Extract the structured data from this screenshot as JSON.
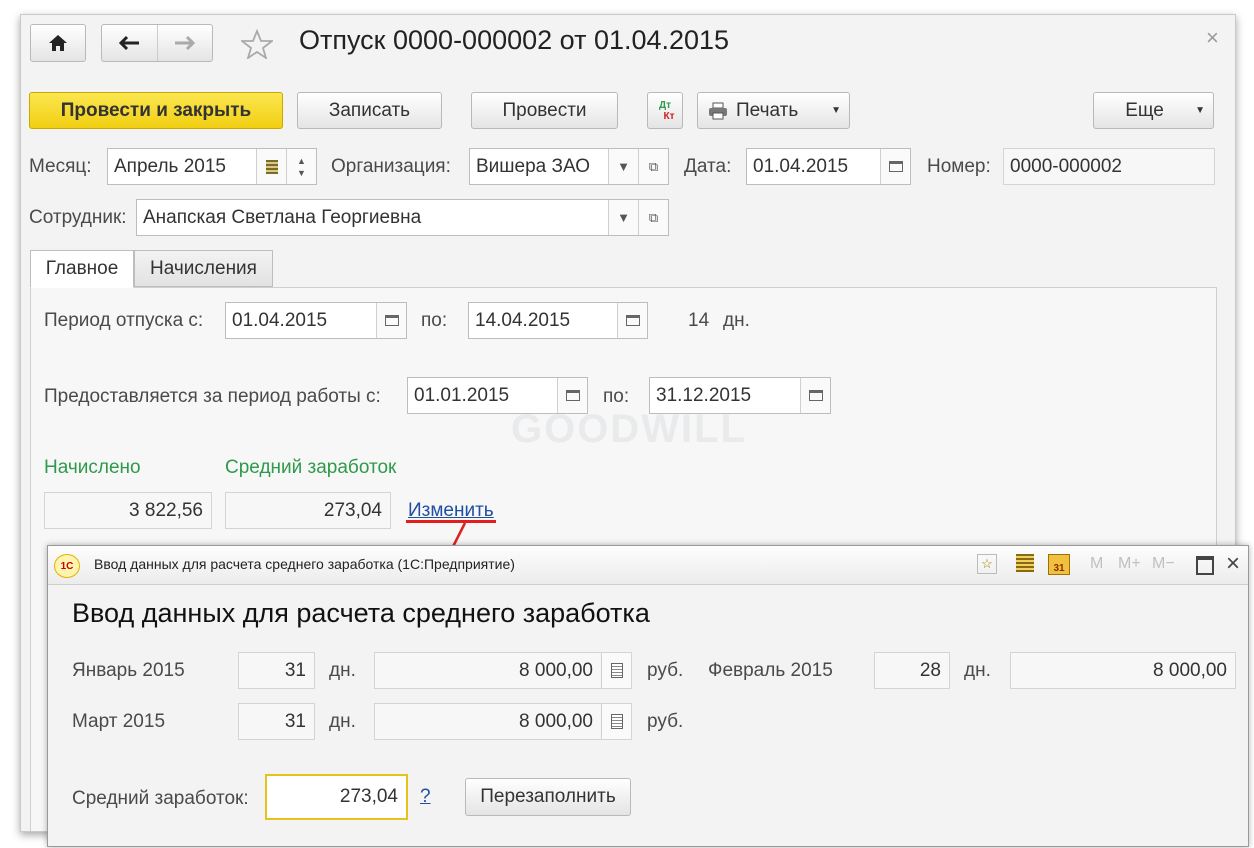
{
  "window": {
    "title": "Отпуск 0000-000002 от 01.04.2015",
    "close_glyph": "×"
  },
  "toolbar": {
    "post_close": "Провести и закрыть",
    "save": "Записать",
    "post": "Провести",
    "dtkt_top": "Дт",
    "dtkt_bottom": "Кт",
    "print": "Печать",
    "more": "Еще"
  },
  "header": {
    "month_label": "Месяц:",
    "month_value": "Апрель 2015",
    "org_label": "Организация:",
    "org_value": "Вишера ЗАО",
    "date_label": "Дата:",
    "date_value": "01.04.2015",
    "number_label": "Номер:",
    "number_value": "0000-000002",
    "employee_label": "Сотрудник:",
    "employee_value": "Анапская Светлана Георгиевна"
  },
  "tabs": [
    {
      "label": "Главное"
    },
    {
      "label": "Начисления"
    }
  ],
  "main": {
    "period_label": "Период отпуска с:",
    "period_from": "01.04.2015",
    "to_label": "по:",
    "period_to": "14.04.2015",
    "days_count": "14",
    "days_unit": "дн.",
    "work_period_label": "Предоставляется за период работы с:",
    "work_from": "01.01.2015",
    "work_to_label": "по:",
    "work_to": "31.12.2015",
    "accrued_label": "Начислено",
    "accrued_value": "3 822,56",
    "avg_label": "Средний заработок",
    "avg_value": "273,04",
    "change_link": "Изменить"
  },
  "watermark": "GOODWILL",
  "dialog": {
    "logo": "1С",
    "titlebar": "Ввод данных для расчета среднего заработка  (1С:Предприятие)",
    "toolbar_icons": [
      "M",
      "M+",
      "M−"
    ],
    "heading": "Ввод данных для расчета среднего заработка",
    "rows": [
      {
        "month": "Январь 2015",
        "days": "31",
        "days_unit": "дн.",
        "amount": "8 000,00",
        "currency": "руб."
      },
      {
        "month": "Февраль 2015",
        "days": "28",
        "days_unit": "дн.",
        "amount": "8 000,00"
      },
      {
        "month": "Март 2015",
        "days": "31",
        "days_unit": "дн.",
        "amount": "8 000,00",
        "currency": "руб."
      }
    ],
    "avg_label": "Средний заработок:",
    "avg_value": "273,04",
    "help": "?",
    "refill": "Перезаполнить"
  },
  "colors": {
    "primary_button": "#f1cf12",
    "green_label": "#2e9a4a",
    "link": "#1f4ea3",
    "annotation": "#e02020",
    "active_field": "#e6c21a"
  }
}
